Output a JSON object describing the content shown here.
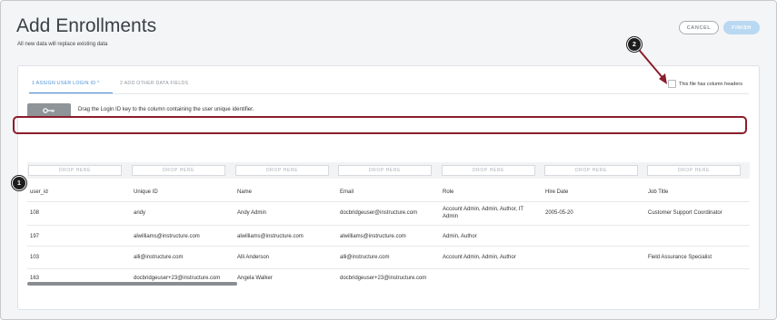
{
  "header": {
    "title": "Add Enrollments",
    "subtitle": "All new data will replace existing data",
    "cancel_label": "CANCEL",
    "finish_label": "FINISH"
  },
  "tabs": [
    {
      "label": "1   ASSIGN USER LOGIN ID *",
      "active": true
    },
    {
      "label": "2   ADD OTHER DATA FIELDS",
      "active": false
    }
  ],
  "column_headers_checkbox": {
    "label": "This file has column headers",
    "checked": false
  },
  "key_button": {
    "icon": "key-icon"
  },
  "instruction": "Drag the Login ID key to the column containing the user unique identifier.",
  "drop_label": "DROP HERE",
  "columns": [
    "user_id",
    "Unique ID",
    "Name",
    "Email",
    "Role",
    "Hire Date",
    "Job Title"
  ],
  "rows": [
    [
      "108",
      "andy",
      "Andy Admin",
      "docbridgeuser@instructure.com",
      "Account Admin, Admin, Author, IT Admin",
      "2005-05-20",
      "Customer Support Coordinator"
    ],
    [
      "197",
      "alwilliams@instructure.com",
      "alwilliams@instructure.com",
      "alwilliams@instructure.com",
      "Admin, Author",
      "",
      ""
    ],
    [
      "103",
      "alli@instructure.com",
      "Alli Anderson",
      "alli@instructure.com",
      "Account Admin, Admin, Author",
      "",
      "Field Assurance Specialist"
    ],
    [
      "163",
      "docbridgeuser+23@instructure.com",
      "Angela Walker",
      "docbridgeuser+23@instructure.com",
      "",
      "",
      ""
    ]
  ],
  "callouts": [
    "1",
    "2"
  ],
  "colors": {
    "accent": "#4a90d9",
    "highlight": "#8b1d2c",
    "finish_disabled": "#b9d8f2"
  }
}
